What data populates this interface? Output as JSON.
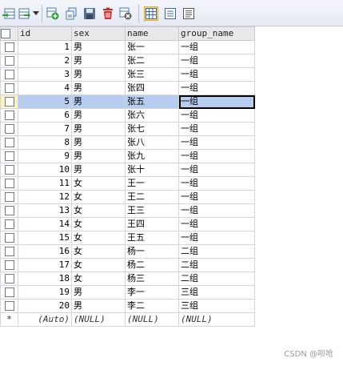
{
  "toolbar": {
    "icons": [
      "import-table-icon",
      "export-dropdown-icon",
      "add-row-icon",
      "duplicate-row-icon",
      "save-icon",
      "delete-icon",
      "cancel-icon",
      "grid-view-icon",
      "form-view-icon",
      "text-view-icon"
    ],
    "colors": {
      "accent": "#2d6fc4",
      "delete": "#d32f2f",
      "add": "#2e9d3a"
    }
  },
  "table": {
    "columns": [
      "id",
      "sex",
      "name",
      "group_name"
    ],
    "rows": [
      {
        "id": "1",
        "sex": "男",
        "name": "张一",
        "group_name": "一组"
      },
      {
        "id": "2",
        "sex": "男",
        "name": "张二",
        "group_name": "一组"
      },
      {
        "id": "3",
        "sex": "男",
        "name": "张三",
        "group_name": "一组"
      },
      {
        "id": "4",
        "sex": "男",
        "name": "张四",
        "group_name": "一组"
      },
      {
        "id": "5",
        "sex": "男",
        "name": "张五",
        "group_name": "一组"
      },
      {
        "id": "6",
        "sex": "男",
        "name": "张六",
        "group_name": "一组"
      },
      {
        "id": "7",
        "sex": "男",
        "name": "张七",
        "group_name": "一组"
      },
      {
        "id": "8",
        "sex": "男",
        "name": "张八",
        "group_name": "一组"
      },
      {
        "id": "9",
        "sex": "男",
        "name": "张九",
        "group_name": "一组"
      },
      {
        "id": "10",
        "sex": "男",
        "name": "张十",
        "group_name": "一组"
      },
      {
        "id": "11",
        "sex": "女",
        "name": "王一",
        "group_name": "一组"
      },
      {
        "id": "12",
        "sex": "女",
        "name": "王二",
        "group_name": "一组"
      },
      {
        "id": "13",
        "sex": "女",
        "name": "王三",
        "group_name": "一组"
      },
      {
        "id": "14",
        "sex": "女",
        "name": "王四",
        "group_name": "一组"
      },
      {
        "id": "15",
        "sex": "女",
        "name": "王五",
        "group_name": "一组"
      },
      {
        "id": "16",
        "sex": "女",
        "name": "杨一",
        "group_name": "二组"
      },
      {
        "id": "17",
        "sex": "女",
        "name": "杨二",
        "group_name": "二组"
      },
      {
        "id": "18",
        "sex": "女",
        "name": "杨三",
        "group_name": "二组"
      },
      {
        "id": "19",
        "sex": "男",
        "name": "李一",
        "group_name": "三组"
      },
      {
        "id": "20",
        "sex": "男",
        "name": "李二",
        "group_name": "三组"
      }
    ],
    "selected_row_id": "5",
    "new_row": {
      "marker": "*",
      "id": "(Auto)",
      "sex": "(NULL)",
      "name": "(NULL)",
      "group_name": "(NULL)"
    }
  },
  "watermark": "CSDN @呗呛"
}
